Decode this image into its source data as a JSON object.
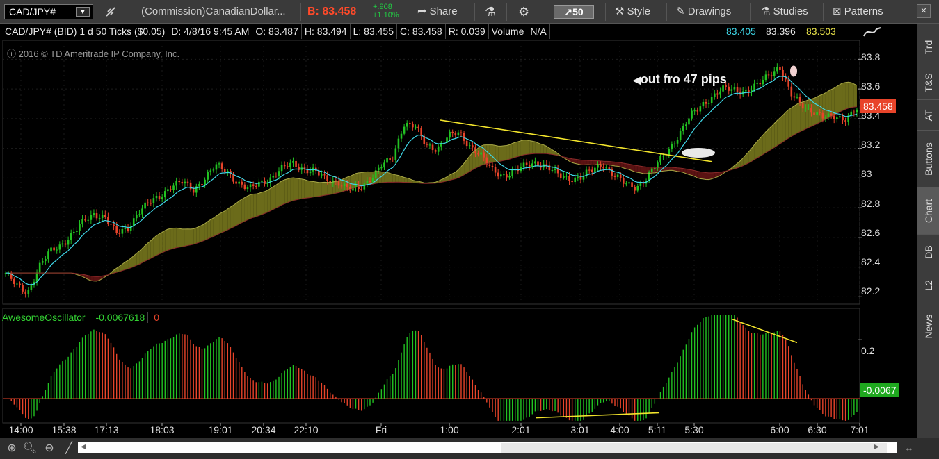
{
  "toolbar": {
    "symbol": "CAD/JPY#",
    "description": "(Commission)CanadianDollar...",
    "bid_label": "B: 83.458",
    "change_abs": "+.908",
    "change_pct": "+1.10%",
    "share_label": "Share",
    "ticks_label": "50",
    "style_label": "Style",
    "drawings_label": "Drawings",
    "studies_label": "Studies",
    "patterns_label": "Patterns"
  },
  "infobar": {
    "title": "CAD/JPY# (BID) 1 d 50 Ticks ($0.05)",
    "date": "D: 4/8/16 9:45 AM",
    "open": "O: 83.487",
    "high": "H: 83.494",
    "low": "L: 83.455",
    "close": "C: 83.458",
    "range": "R: 0.039",
    "volume_label": "Volume",
    "volume_value": "N/A",
    "v1": "83.405",
    "v2": "83.396",
    "v3": "83.503"
  },
  "watermark": "2016 © TD Ameritrade IP Company, Inc.",
  "annotation": "out fro 47 pips",
  "price_axis": [
    "83.8",
    "83.6",
    "83.4",
    "83.2",
    "83",
    "82.8",
    "82.6",
    "82.4",
    "82.2"
  ],
  "last_price": "83.458",
  "oscillator": {
    "name": "AwesomeOscillator",
    "value": "-0.0067618",
    "zero": "0",
    "axis_label": "0.2",
    "current_badge": "-0.0067"
  },
  "time_axis": [
    "14:00",
    "15:38",
    "17:13",
    "18:03",
    "19:01",
    "20:34",
    "22:10",
    "Fri",
    "1:00",
    "2:01",
    "3:01",
    "4:00",
    "5:11",
    "5:30",
    "6:00",
    "6:30",
    "7:01"
  ],
  "right_tabs": [
    "Trd",
    "T&S",
    "AT",
    "Buttons",
    "Chart",
    "DB",
    "L2",
    "News"
  ],
  "colors": {
    "up": "#22c322",
    "down": "#e8442a",
    "cloud_bull": "#6b6b1a",
    "cloud_bear": "#5a1212",
    "tenkan": "#3fd7e8",
    "trend": "#f2e42c",
    "last_badge": "#e8442a",
    "ao_badge": "#1fa81f"
  },
  "chart_data": {
    "type": "candlestick",
    "series": [
      {
        "name": "CAD/JPY#",
        "close": [
          82.36,
          82.27,
          82.23,
          82.4,
          82.5,
          82.55,
          82.62,
          82.7,
          82.76,
          82.74,
          82.62,
          82.66,
          82.77,
          82.83,
          82.88,
          82.95,
          82.97,
          82.92,
          83.0,
          83.08,
          83.05,
          82.97,
          82.92,
          82.97,
          83.0,
          83.06,
          83.1,
          83.06,
          83.04,
          82.99,
          82.98,
          82.92,
          82.93,
          83.0,
          83.08,
          83.13,
          83.37,
          83.35,
          83.22,
          83.2,
          83.28,
          83.3,
          83.22,
          83.15,
          83.05,
          83.02,
          83.04,
          83.08,
          83.11,
          83.07,
          83.02,
          83.0,
          83.0,
          83.05,
          83.1,
          83.02,
          82.96,
          82.94,
          83.0,
          83.1,
          83.2,
          83.3,
          83.42,
          83.5,
          83.55,
          83.6,
          83.6,
          83.58,
          83.62,
          83.7,
          83.75,
          83.56,
          83.5,
          83.45,
          83.4,
          83.42,
          83.4,
          83.46
        ]
      }
    ],
    "ylim": [
      82.15,
      83.9
    ],
    "oscillator_ylim": [
      -0.08,
      0.29
    ]
  }
}
